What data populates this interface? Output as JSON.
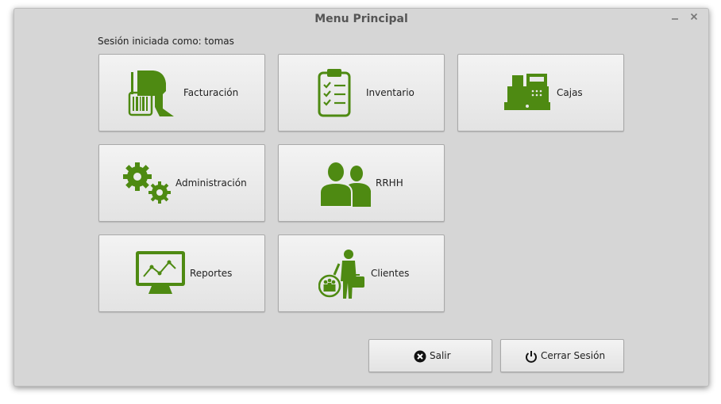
{
  "window": {
    "title": "Menu Principal",
    "minimize_icon": "minimize-icon",
    "close_icon": "close-icon"
  },
  "session": {
    "text": "Sesión iniciada como: tomas"
  },
  "tiles": [
    {
      "label": "Facturación",
      "icon": "barcode-scanner-icon"
    },
    {
      "label": "Inventario",
      "icon": "clipboard-checklist-icon"
    },
    {
      "label": "Cajas",
      "icon": "cash-register-icon"
    },
    {
      "label": "Administración",
      "icon": "gears-icon"
    },
    {
      "label": "RRHH",
      "icon": "people-icon"
    },
    {
      "label": "Reportes",
      "icon": "monitor-chart-icon"
    },
    {
      "label": "Clientes",
      "icon": "businessman-clients-icon"
    }
  ],
  "actions": {
    "exit_label": "Salir",
    "logout_label": "Cerrar Sesión"
  },
  "colors": {
    "accent": "#4e8a12",
    "window_bg": "#d6d6d6",
    "tile_bg": "#ececec"
  }
}
